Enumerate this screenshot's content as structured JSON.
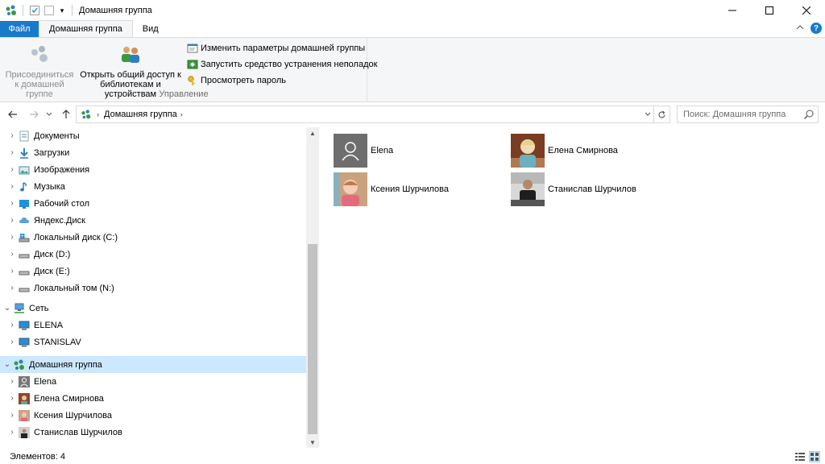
{
  "window": {
    "title": "Домашняя группа"
  },
  "ribbon_tabs": [
    {
      "label": "Файл"
    },
    {
      "label": "Домашняя группа"
    },
    {
      "label": "Вид"
    }
  ],
  "ribbon": {
    "join_label": "Присоединиться к домашней группе",
    "share_label": "Открыть общий доступ к библиотекам и устройствам",
    "change_settings_label": "Изменить параметры домашней группы",
    "troubleshooter_label": "Запустить средство устранения неполадок",
    "view_password_label": "Просмотреть пароль",
    "group_label": "Управление"
  },
  "address": {
    "crumb": "Домашняя группа",
    "search_placeholder": "Поиск: Домашняя группа"
  },
  "tree": [
    {
      "label": "Документы",
      "icon": "documents-icon"
    },
    {
      "label": "Загрузки",
      "icon": "downloads-icon"
    },
    {
      "label": "Изображения",
      "icon": "pictures-icon"
    },
    {
      "label": "Музыка",
      "icon": "music-icon"
    },
    {
      "label": "Рабочий стол",
      "icon": "desktop-icon"
    },
    {
      "label": "Яндекс.Диск",
      "icon": "yandex-disk-icon"
    },
    {
      "label": "Локальный диск (C:)",
      "icon": "system-drive-icon"
    },
    {
      "label": "Диск (D:)",
      "icon": "drive-icon"
    },
    {
      "label": "Диск (E:)",
      "icon": "drive-icon"
    },
    {
      "label": "Локальный том (N:)",
      "icon": "drive-icon"
    },
    {
      "label": "Сеть",
      "icon": "network-icon"
    },
    {
      "label": "ELENA",
      "icon": "computer-icon"
    },
    {
      "label": "STANISLAV",
      "icon": "computer-icon"
    },
    {
      "label": "Домашняя группа",
      "icon": "homegroup-icon"
    },
    {
      "label": "Elena",
      "icon": "user-avatar-icon"
    },
    {
      "label": "Елена Смирнова",
      "icon": "user-photo-icon"
    },
    {
      "label": "Ксения Шурчилова",
      "icon": "user-photo-icon"
    },
    {
      "label": "Станислав Шурчилов",
      "icon": "user-photo-icon"
    }
  ],
  "members": [
    {
      "name": "Elena"
    },
    {
      "name": "Елена Смирнова"
    },
    {
      "name": "Ксения Шурчилова"
    },
    {
      "name": "Станислав Шурчилов"
    }
  ],
  "status": {
    "items_count": "Элементов: 4"
  },
  "colors": {
    "accent": "#1979ca",
    "selection": "#cce8ff",
    "homegroup_green": "#3a9a3a"
  }
}
